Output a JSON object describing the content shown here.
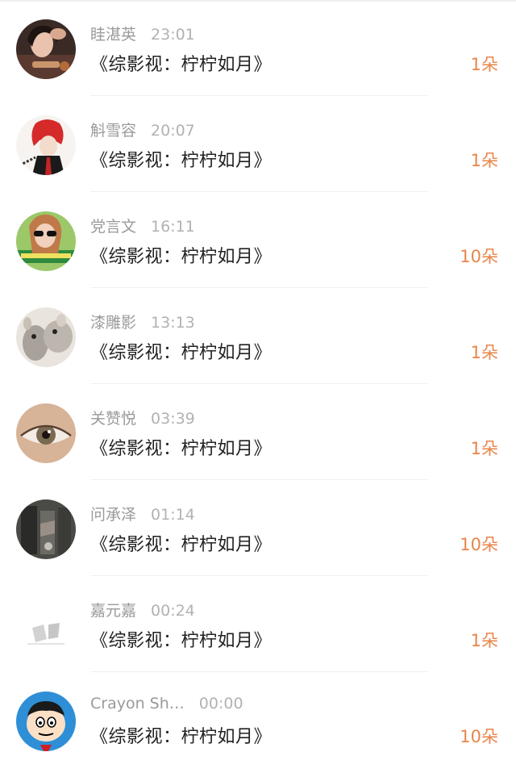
{
  "rows": [
    {
      "name": "眭湛英",
      "time": "23:01",
      "title": "《综影视：柠柠如月》",
      "amount": "1朵",
      "avatar": "avatar-woman-dark"
    },
    {
      "name": "斛雪容",
      "time": "20:07",
      "title": "《综影视：柠柠如月》",
      "amount": "1朵",
      "avatar": "avatar-anime-red-hair"
    },
    {
      "name": "党言文",
      "time": "16:11",
      "title": "《综影视：柠柠如月》",
      "amount": "10朵",
      "avatar": "avatar-woman-sunglasses"
    },
    {
      "name": "漆雕影",
      "time": "13:13",
      "title": "《综影视：柠柠如月》",
      "amount": "1朵",
      "avatar": "avatar-chinchillas"
    },
    {
      "name": "关赞悦",
      "time": "03:39",
      "title": "《综影视：柠柠如月》",
      "amount": "1朵",
      "avatar": "avatar-eye"
    },
    {
      "name": "问承泽",
      "time": "01:14",
      "title": "《综影视：柠柠如月》",
      "amount": "10朵",
      "avatar": "avatar-dark-scene"
    },
    {
      "name": "嘉元嘉",
      "time": "00:24",
      "title": "《综影视：柠柠如月》",
      "amount": "1朵",
      "avatar": "avatar-white-sketch"
    },
    {
      "name": "Crayon Sh…",
      "time": "00:00",
      "title": "《综影视：柠柠如月》",
      "amount": "10朵",
      "avatar": "avatar-cartoon-boy"
    }
  ],
  "colors": {
    "amount": "#e8864a",
    "name": "#9a9a9a",
    "title": "#222222"
  }
}
